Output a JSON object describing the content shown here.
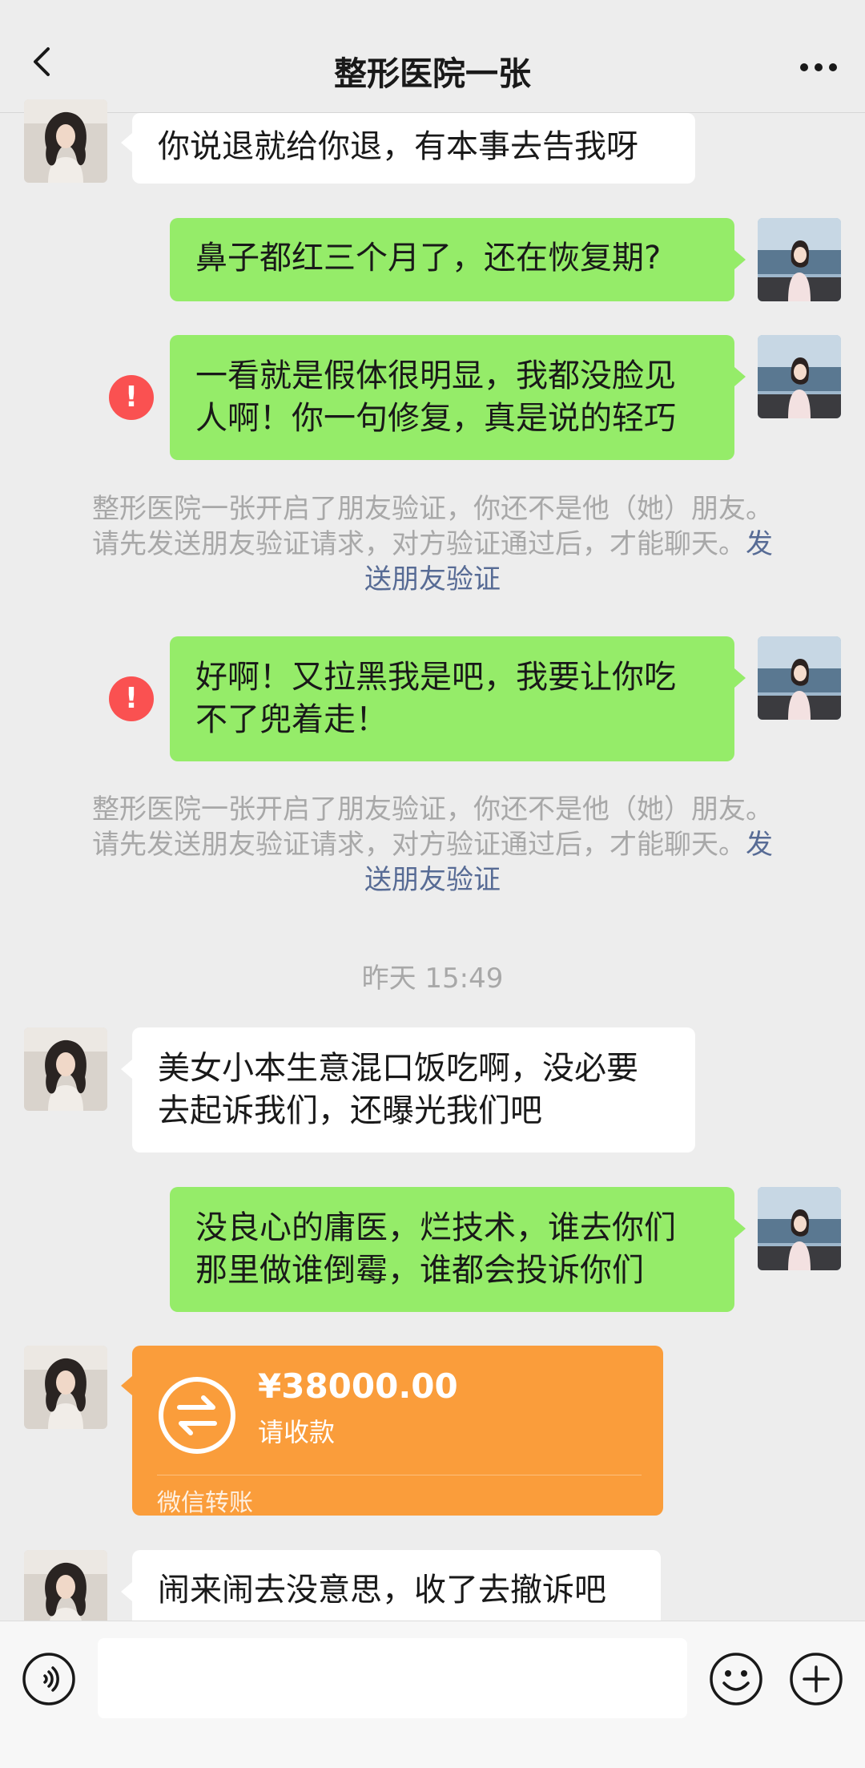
{
  "header": {
    "title": "整形医院一张",
    "back_icon": "chevron-left-icon",
    "more_icon": "more-dots-icon"
  },
  "messages": [
    {
      "side": "in",
      "lines": [
        "你说退就给你退，有本事去告我呀"
      ]
    },
    {
      "side": "out",
      "lines": [
        "鼻子都红三个月了，还在恢复期?"
      ]
    },
    {
      "side": "out",
      "error": true,
      "lines": [
        "一看就是假体很明显，我都没脸见",
        "人啊！你一句修复，真是说的轻巧"
      ]
    },
    {
      "side": "out",
      "error": true,
      "lines": [
        "好啊！又拉黑我是吧，我要让你吃",
        "不了兜着走！"
      ]
    },
    {
      "side": "in",
      "lines": [
        "美女小本生意混口饭吃啊，没必要",
        "去起诉我们，还曝光我们吧"
      ]
    },
    {
      "side": "out",
      "lines": [
        "没良心的庸医，烂技术，谁去你们",
        "那里做谁倒霉，谁都会投诉你们"
      ]
    },
    {
      "side": "in",
      "lines": [
        "闹来闹去没意思，收了去撤诉吧"
      ]
    }
  ],
  "system_notices": [
    {
      "line1": "整形医院一张开启了朋友验证，你还不是他（她）朋友。",
      "line2": "请先发送朋友验证请求，对方验证通过后，才能聊天。",
      "link_a": "发",
      "link_b": "送朋友验证"
    },
    {
      "line1": "整形医院一张开启了朋友验证，你还不是他（她）朋友。",
      "line2": "请先发送朋友验证请求，对方验证通过后，才能聊天。",
      "link_a": "发",
      "link_b": "送朋友验证"
    }
  ],
  "timestamp": "昨天 15:49",
  "transfer": {
    "amount": "¥38000.00",
    "note": "请收款",
    "footer": "微信转账",
    "icon": "transfer-arrows-icon"
  },
  "bottom_bar": {
    "voice_icon": "voice-icon",
    "emoji_icon": "emoji-icon",
    "plus_icon": "plus-icon",
    "input_value": ""
  },
  "colors": {
    "background": "#ededed",
    "outgoing_bubble": "#95ec69",
    "incoming_bubble": "#ffffff",
    "error": "#fa5151",
    "transfer": "#fa9d3b",
    "link": "#576b95"
  }
}
